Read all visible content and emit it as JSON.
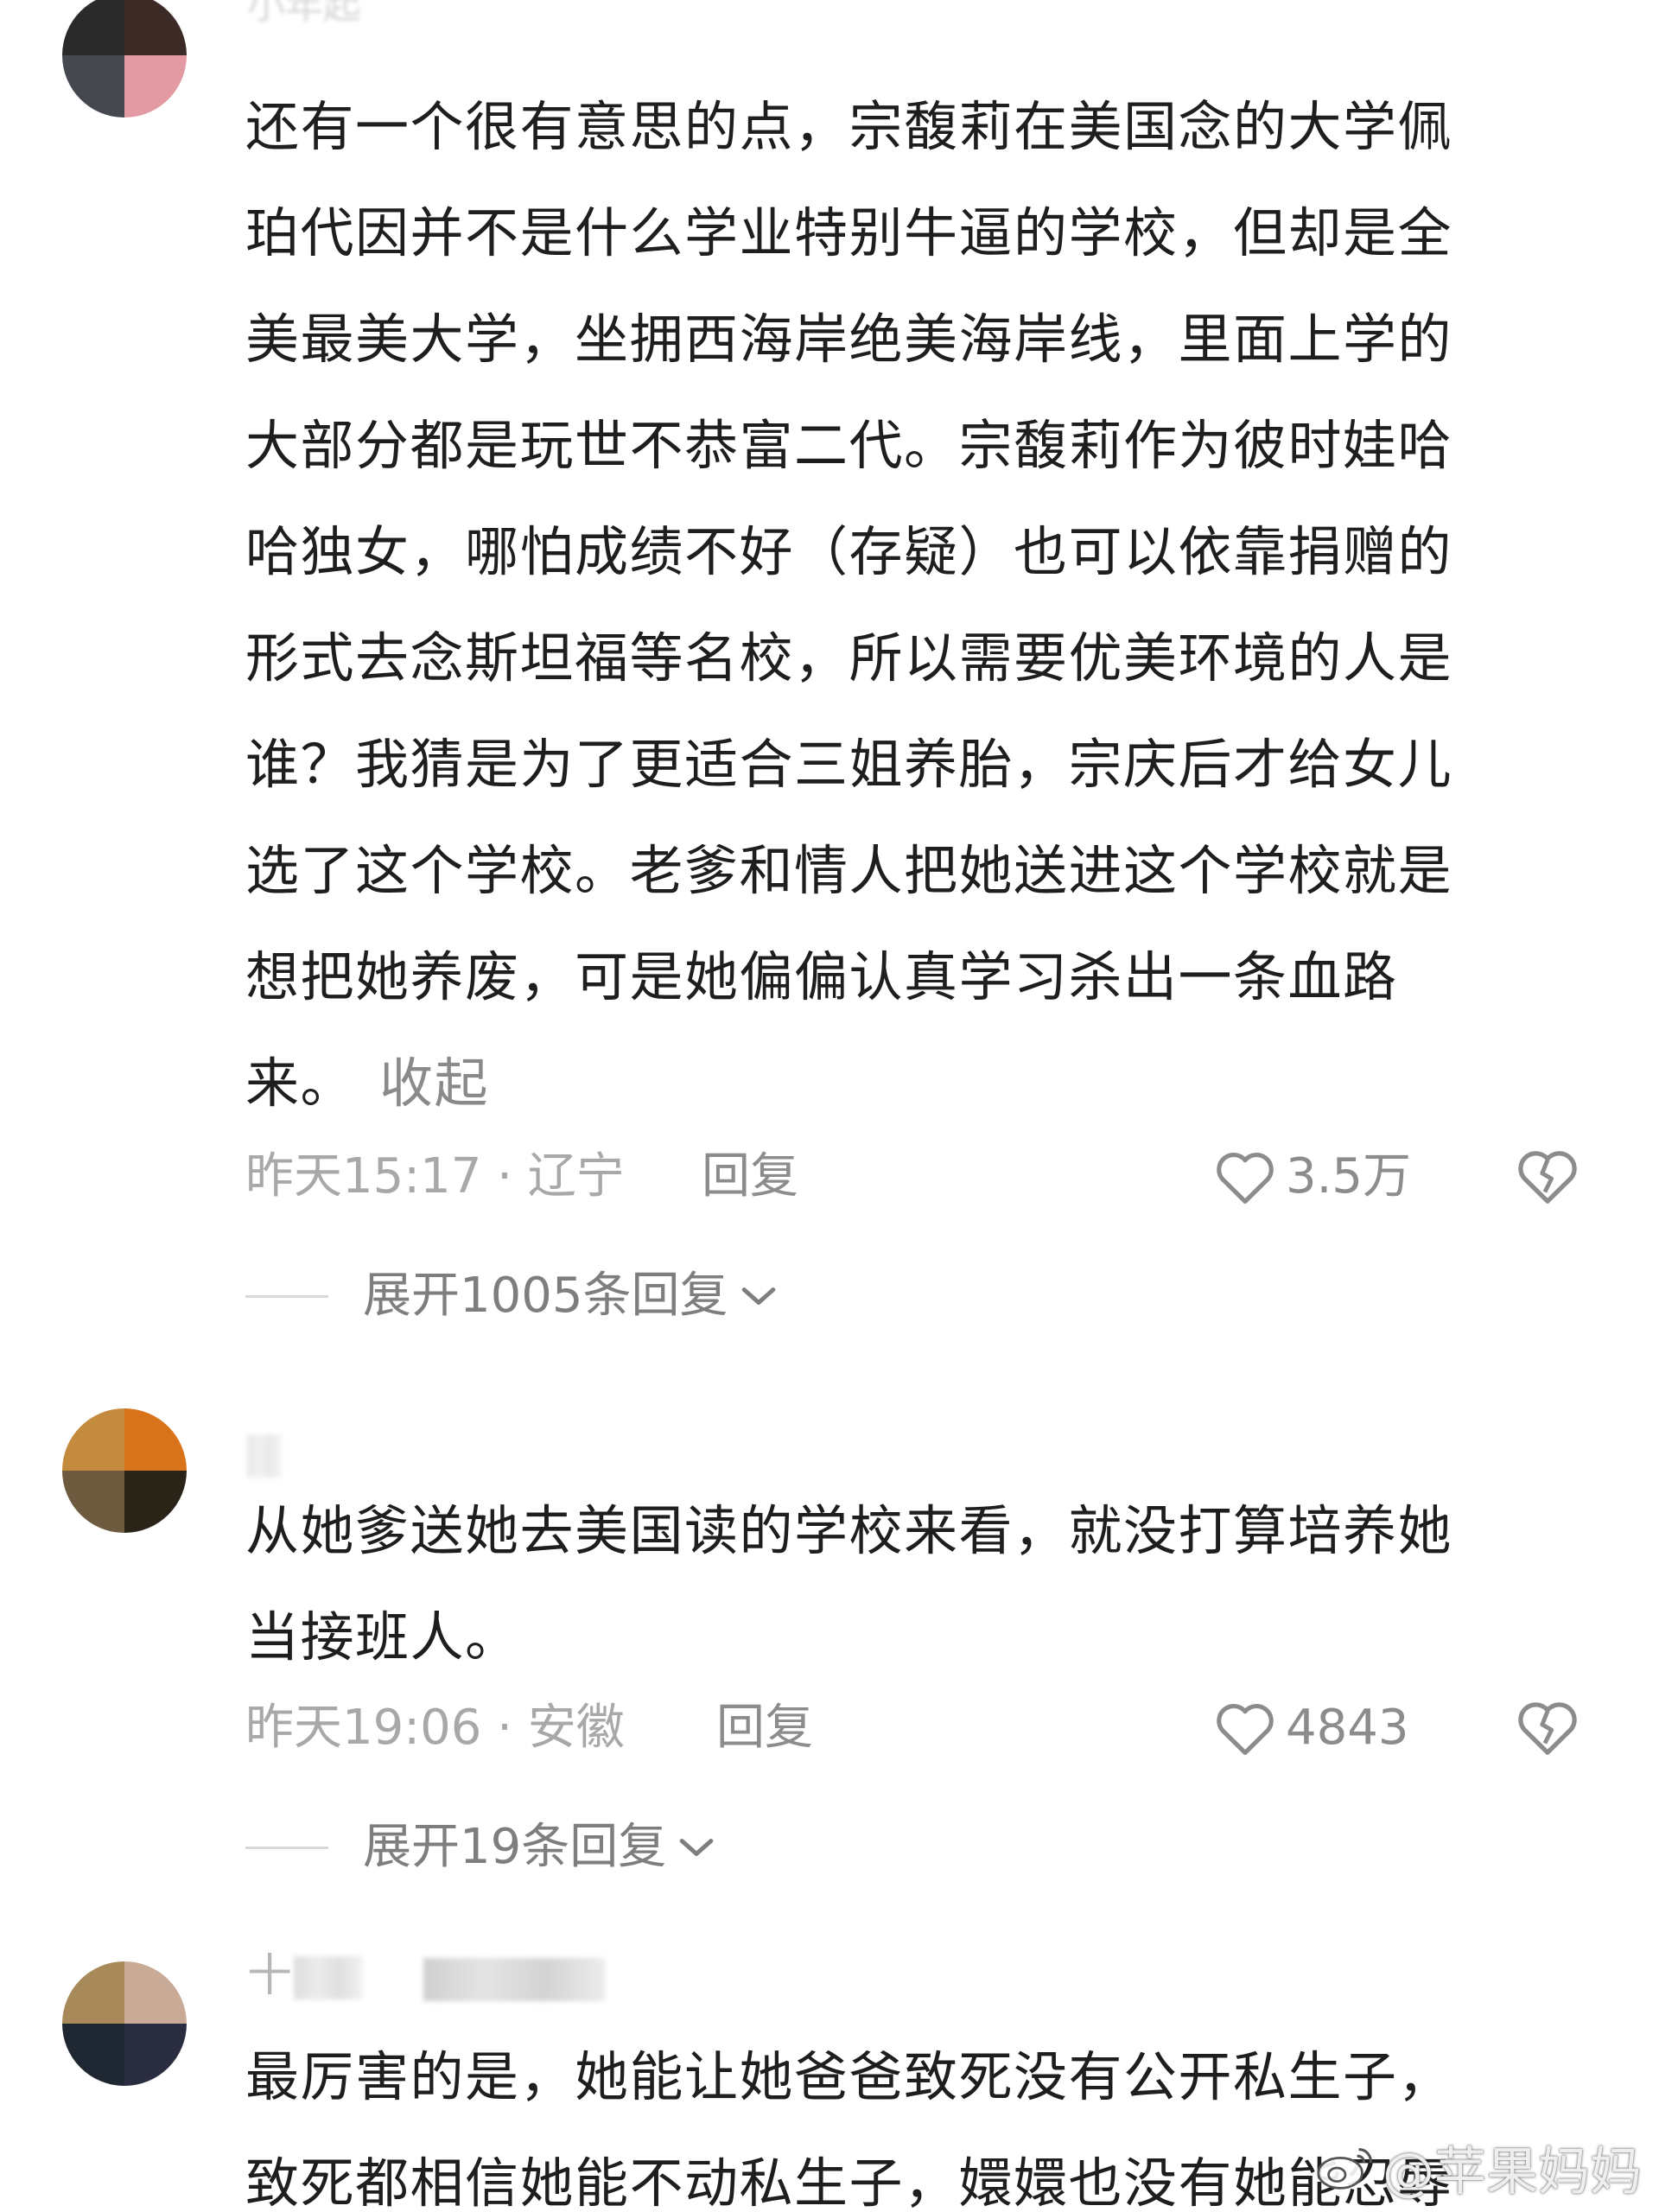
{
  "comments": [
    {
      "username": "小年起",
      "text": "还有一个很有意思的点，宗馥莉在美国念的大学佩\n珀代因并不是什么学业特别牛逼的学校，但却是全\n美最美大学，坐拥西海岸绝美海岸线，里面上学的\n大部分都是玩世不恭富二代。宗馥莉作为彼时娃哈\n哈独女，哪怕成绩不好（存疑）也可以依靠捐赠的\n形式去念斯坦福等名校，所以需要优美环境的人是\n谁？我猜是为了更适合三姐养胎，宗庆后才给女儿\n选了这个学校。老爹和情人把她送进这个学校就是\n想把她养废，可是她偏偏认真学习杀出一条血路\n来。",
      "collapse_label": "收起",
      "time_location": "昨天15:17 · 辽宁",
      "reply_label": "回复",
      "like_count": "3.5万",
      "expand_label": "展开1005条回复",
      "avatar_colors": [
        "#2a2a2a",
        "#3b2a26",
        "#45484f",
        "#e39aa3"
      ]
    },
    {
      "username": "",
      "text": "从她爹送她去美国读的学校来看，就没打算培养她\n当接班人。",
      "time_location": "昨天19:06 · 安徽",
      "reply_label": "回复",
      "like_count": "4843",
      "expand_label": "展开19条回复",
      "avatar_colors": [
        "#c48a3e",
        "#d8731a",
        "#6e5a3e",
        "#2a2418"
      ]
    },
    {
      "username": "十",
      "text": "最厉害的是，她能让她爸爸致死没有公开私生子，\n致死都相信她能不动私生子，嬛嬛也没有她能忍辱",
      "avatar_colors": [
        "#a88a5a",
        "#c8aa96",
        "#1f2733",
        "#2a2d3f"
      ]
    }
  ],
  "watermark": "@苹果妈妈",
  "icons": {
    "like": "heart-outline-icon",
    "dislike": "broken-heart-icon",
    "expand": "chevron-down-icon",
    "watermark": "weibo-logo-icon"
  }
}
